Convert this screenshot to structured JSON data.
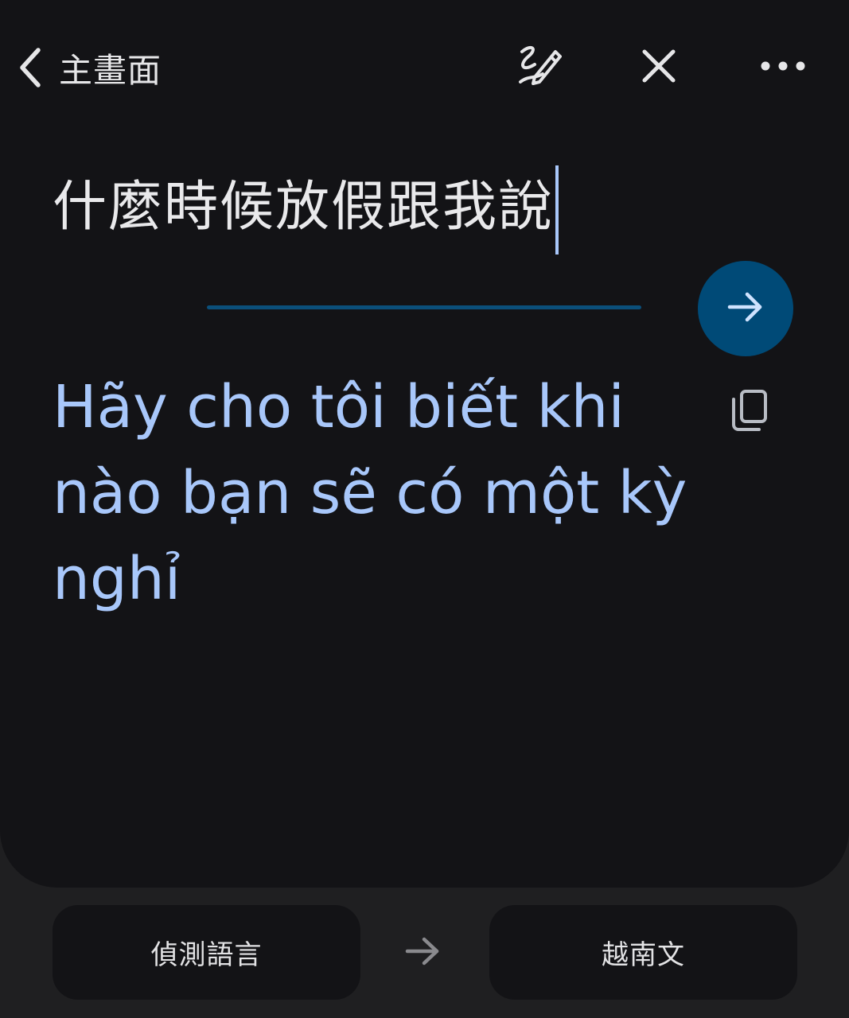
{
  "topbar": {
    "back_label": "主畫面",
    "back_icon": "chevron-left-icon",
    "handwriting_icon": "handwriting-pen-icon",
    "close_icon": "close-icon",
    "more_icon": "more-horizontal-icon"
  },
  "source": {
    "text": "什麼時候放假跟我說"
  },
  "translate_button_icon": "arrow-right-icon",
  "translation": {
    "text": "Hãy cho tôi biết khi nào bạn sẽ có một kỳ nghỉ",
    "copy_icon": "copy-icon"
  },
  "languages": {
    "source_label": "偵測語言",
    "target_label": "越南文",
    "swap_icon": "arrow-right-icon"
  },
  "colors": {
    "background": "#131316",
    "accent_text": "#a8c7fa",
    "button": "#004a77"
  }
}
